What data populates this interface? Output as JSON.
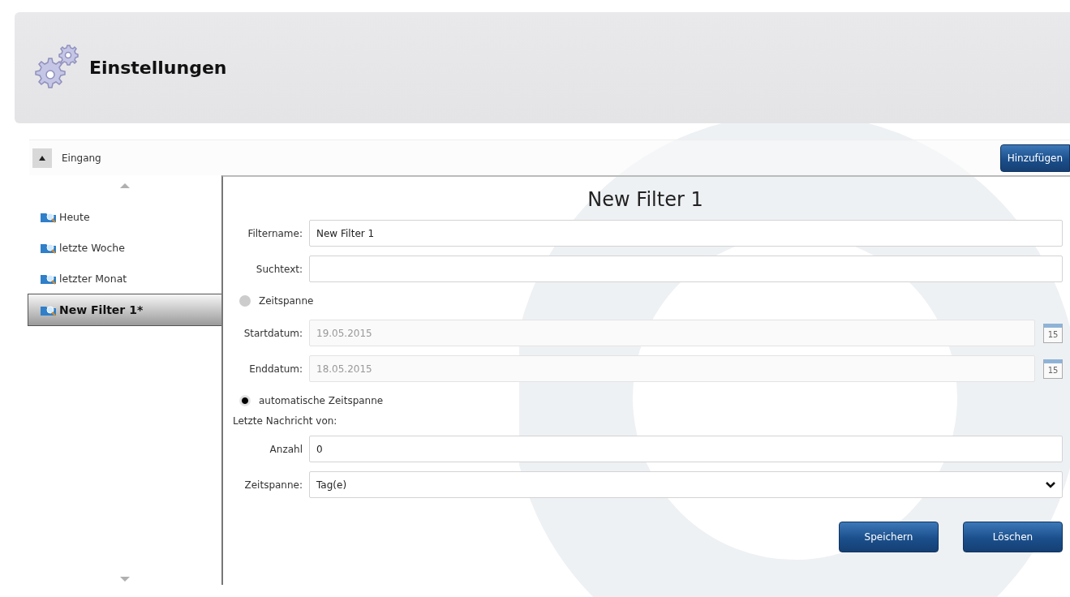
{
  "header": {
    "title": "Einstellungen"
  },
  "section": {
    "title": "Eingang",
    "expanded": true
  },
  "add_button": "Hinzufügen",
  "filters": [
    {
      "label": "Heute",
      "selected": false
    },
    {
      "label": "letzte Woche",
      "selected": false
    },
    {
      "label": "letzter Monat",
      "selected": false
    },
    {
      "label": "New Filter 1*",
      "selected": true
    }
  ],
  "form": {
    "title": "New Filter 1",
    "fields": [
      {
        "kind": "text",
        "label": "Filtername:",
        "value": "New Filter 1",
        "disabled": false
      },
      {
        "kind": "text",
        "label": "Suchtext:",
        "disabled": false
      },
      {
        "kind": "radio",
        "label": "Zeitspanne",
        "selected": false
      },
      {
        "kind": "date",
        "label": "Startdatum:",
        "value": "19.05.2015",
        "disabled": true,
        "icon_text": "15"
      },
      {
        "kind": "date",
        "label": "Enddatum:",
        "value": "18.05.2015",
        "disabled": true,
        "icon_text": "15"
      },
      {
        "kind": "radio",
        "label": "automatische Zeitspanne",
        "selected": true
      },
      {
        "kind": "heading",
        "label": "Letzte Nachricht von:"
      },
      {
        "kind": "text",
        "label": "Anzahl",
        "value": "0",
        "disabled": false
      },
      {
        "kind": "select",
        "label": "Zeitspanne:",
        "value": "Tag(e)"
      }
    ],
    "buttons": [
      "Speichern",
      "Löschen"
    ]
  }
}
